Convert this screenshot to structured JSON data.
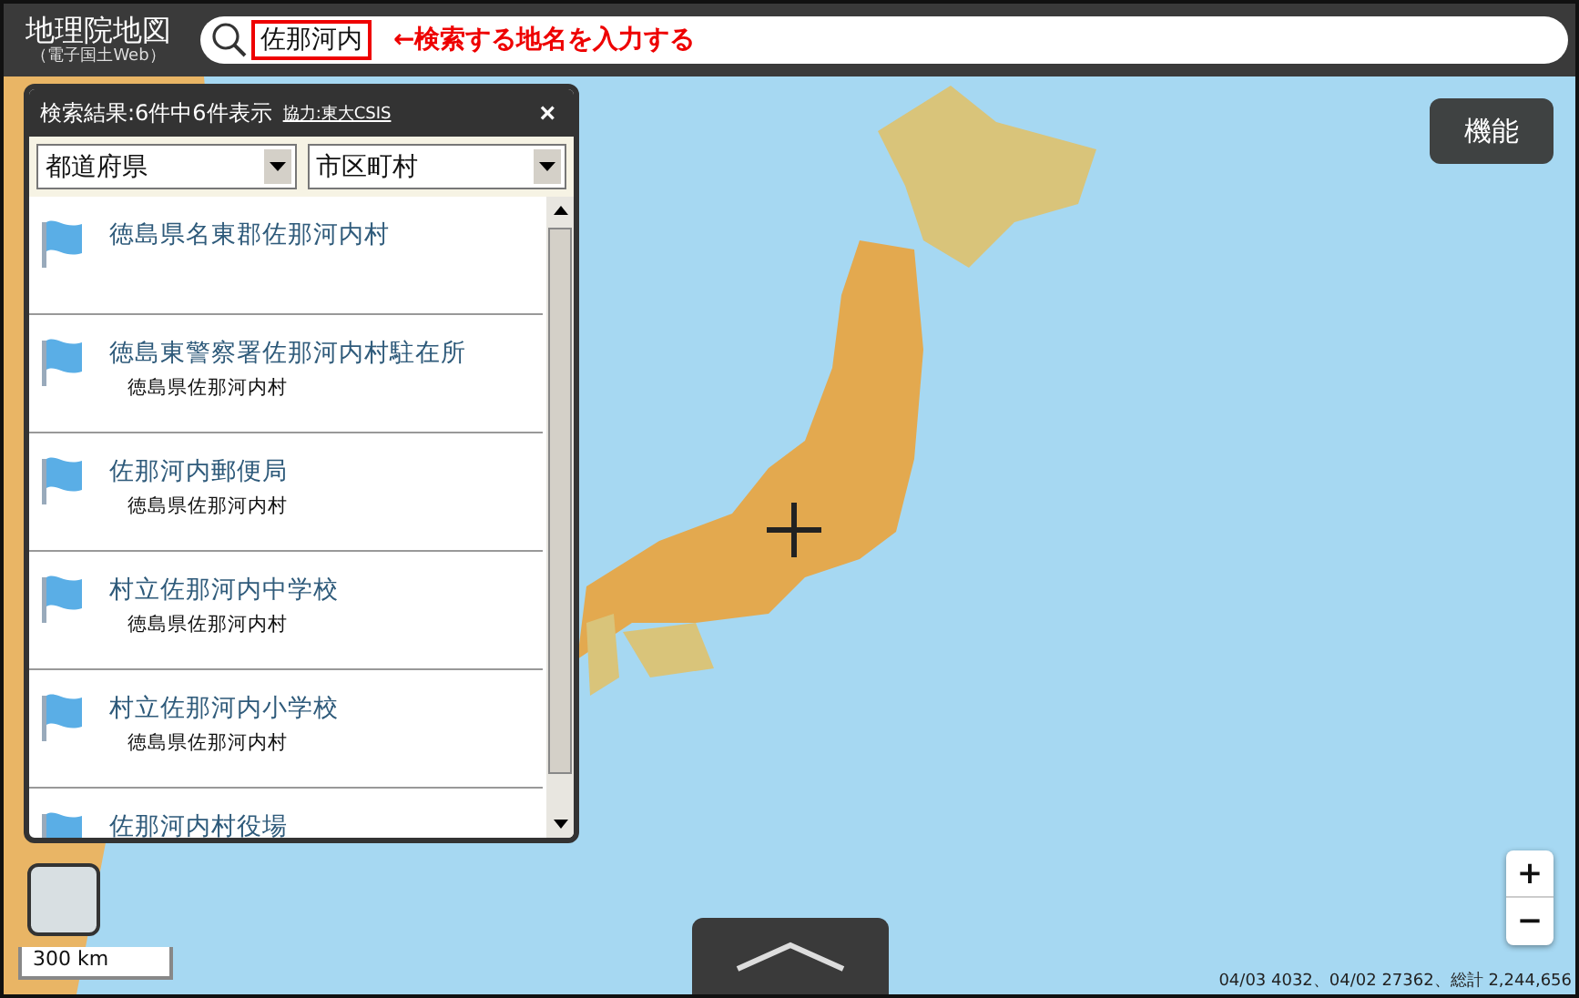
{
  "header": {
    "title": "地理院地図",
    "subtitle": "（電子国土Web）"
  },
  "search": {
    "value": "佐那河内",
    "annotation": "←検索する地名を入力する"
  },
  "results_panel": {
    "title": "検索結果:6件中6件表示",
    "credit_link": "協力:東大CSIS",
    "close": "×",
    "filters": [
      {
        "value": "都道府県"
      },
      {
        "value": "市区町村"
      }
    ],
    "items": [
      {
        "name": "徳島県名東郡佐那河内村"
      },
      {
        "name": "徳島東警察署佐那河内村駐在所",
        "address": "徳島県佐那河内村"
      },
      {
        "name": "佐那河内郵便局",
        "address": "徳島県佐那河内村"
      },
      {
        "name": "村立佐那河内中学校",
        "address": "徳島県佐那河内村"
      },
      {
        "name": "村立佐那河内小学校",
        "address": "徳島県佐那河内村"
      },
      {
        "name": "佐那河内村役場"
      }
    ]
  },
  "function_button": "機能",
  "zoom": {
    "in": "+",
    "out": "−"
  },
  "scale": "300 km",
  "stats": "04/03 4032、04/02 27362、総計 2,244,656"
}
